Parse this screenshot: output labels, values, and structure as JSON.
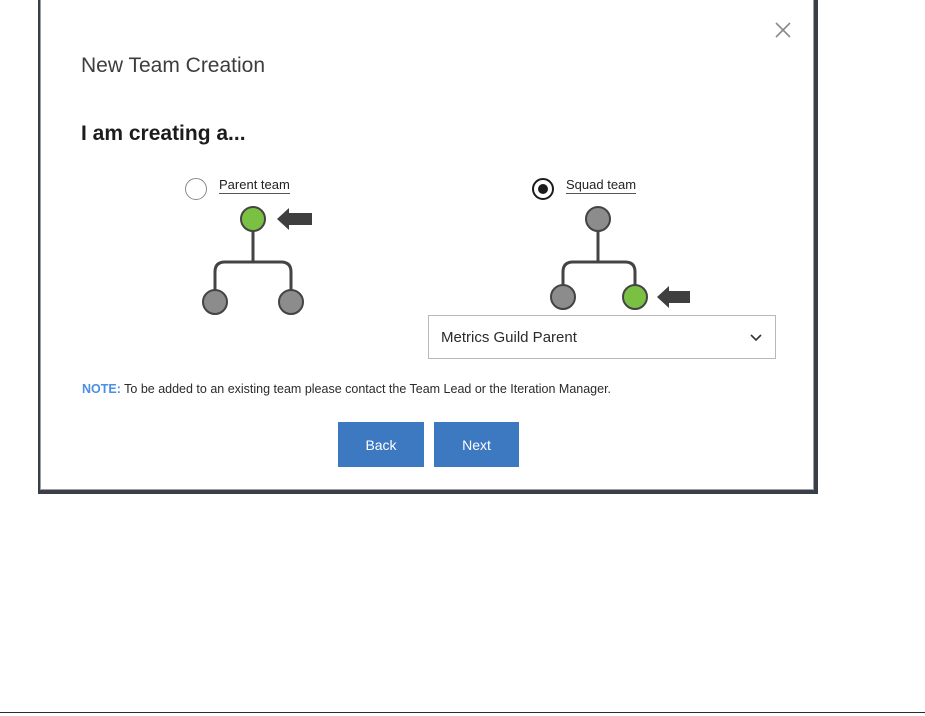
{
  "dialog": {
    "title": "New Team Creation",
    "subtitle": "I am creating a...",
    "close_icon": "close-icon"
  },
  "options": {
    "parent": {
      "label": "Parent team",
      "selected": false
    },
    "squad": {
      "label": "Squad team",
      "selected": true
    }
  },
  "parent_select": {
    "value": "Metrics Guild Parent",
    "icon": "chevron-down-icon"
  },
  "note": {
    "label": "NOTE:",
    "text": " To be added to an existing team please contact the Team Lead or the Iteration Manager."
  },
  "buttons": {
    "back": "Back",
    "next": "Next"
  },
  "colors": {
    "primary_button": "#3d79c1",
    "note_label": "#4a90e2",
    "highlight_node": "#7ac143",
    "default_node": "#8c8c8c"
  }
}
